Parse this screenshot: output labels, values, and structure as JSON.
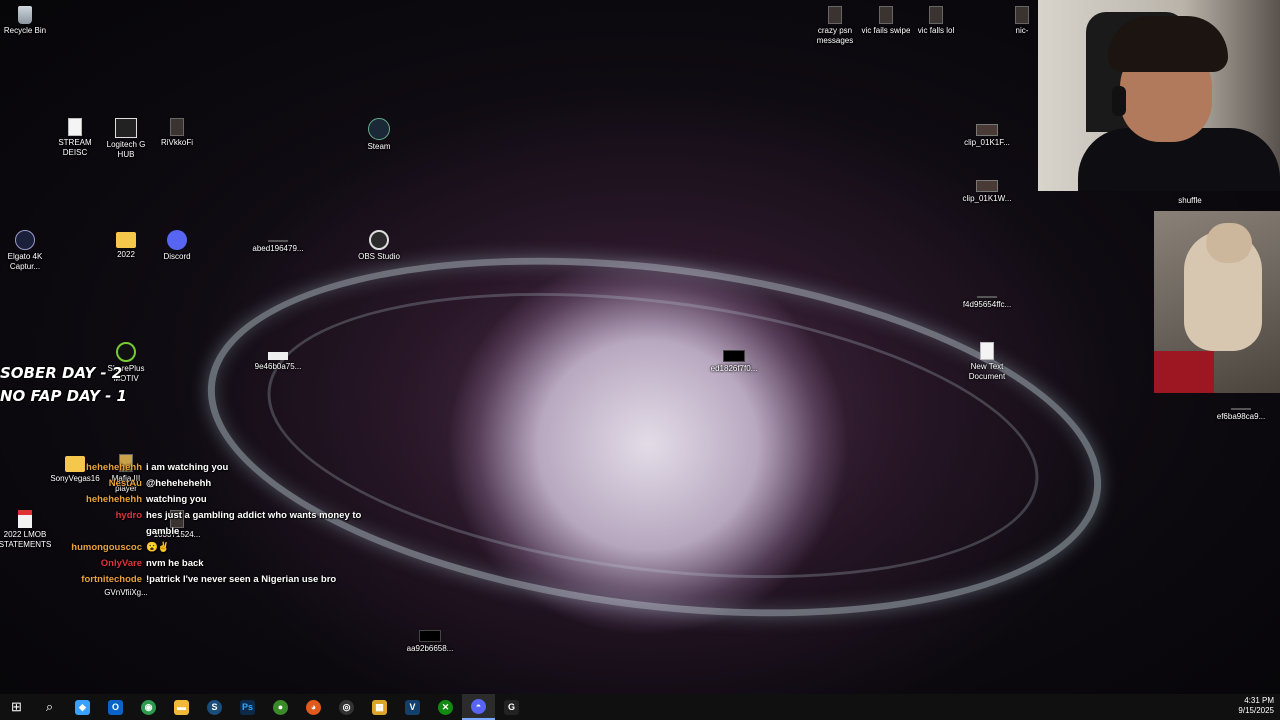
{
  "desktop": {
    "icons": [
      {
        "label": "Recycle Bin"
      },
      {
        "label": "crazy psn\nmessages"
      },
      {
        "label": "vic fails swipe"
      },
      {
        "label": "vic falls lol"
      },
      {
        "label": "nic-"
      },
      {
        "label": "STREAM\nDEISC"
      },
      {
        "label": "Logitech G\nHUB"
      },
      {
        "label": "RiVkkoFi"
      },
      {
        "label": "Steam"
      },
      {
        "label": "clip_01K1F..."
      },
      {
        "label": "clip_01K1W..."
      },
      {
        "label": "Elgato 4K\nCaptur..."
      },
      {
        "label": "2022"
      },
      {
        "label": "Discord"
      },
      {
        "label": "abed196479..."
      },
      {
        "label": "OBS Studio"
      },
      {
        "label": "f4d95654ffc..."
      },
      {
        "label": "ShurePlus\nMOTIV"
      },
      {
        "label": "9e46b0a75..."
      },
      {
        "label": "ed1826f7f0..."
      },
      {
        "label": "New Text\nDocument"
      },
      {
        "label": "ef6ba98ca9..."
      },
      {
        "label": "SonyVegas16"
      },
      {
        "label": "Mafia III\nplayer"
      },
      {
        "label": "2022 LMOB\nSTATEMENTS"
      },
      {
        "label": "103371524..."
      },
      {
        "label": "GVnVfiiXg..."
      },
      {
        "label": "aa92b6658..."
      }
    ]
  },
  "overlay": {
    "sober_line1": "SOBER DAY - 2",
    "sober_line2": "NO FAP DAY - 1",
    "shuffle_label": "shuffle"
  },
  "chat": {
    "messages": [
      {
        "user": "hehehehehh",
        "text": "i am watching you",
        "color": "#e8a33c"
      },
      {
        "user": "NestAu",
        "text": "@hehehehehh",
        "color": "#e8a33c"
      },
      {
        "user": "hehehehehh",
        "text": "watching you",
        "color": "#e8a33c"
      },
      {
        "user": "hydro",
        "text": "hes just a gambling addict who wants money to gamble",
        "color": "#e0343c"
      },
      {
        "user": "humongouscoc",
        "text": "😮✌",
        "color": "#e8a33c"
      },
      {
        "user": "OnlyVare",
        "text": "nvm he back",
        "color": "#e0343c"
      },
      {
        "user": "fortnitechode",
        "text": "!patrick I've never seen a Nigerian use bro",
        "color": "#e8a33c"
      }
    ]
  },
  "taskbar": {
    "items": [
      {
        "name": "windows-start",
        "glyph": "⊞"
      },
      {
        "name": "search",
        "glyph": "⌕"
      },
      {
        "name": "copilot",
        "glyph": "◆",
        "color": "#3aa0ff"
      },
      {
        "name": "outlook",
        "glyph": "O",
        "color": "#0a64c8"
      },
      {
        "name": "chrome",
        "glyph": "◉",
        "color": "#2e9a4e"
      },
      {
        "name": "file-explorer",
        "glyph": "▬",
        "color": "#f2b837"
      },
      {
        "name": "steam",
        "glyph": "S",
        "color": "#1b4d7a"
      },
      {
        "name": "photoshop",
        "glyph": "Ps",
        "color": "#0b2a4a"
      },
      {
        "name": "shure-motiv",
        "glyph": "●",
        "color": "#3a8a2a"
      },
      {
        "name": "firefox",
        "glyph": "◕",
        "color": "#e0591d"
      },
      {
        "name": "obs",
        "glyph": "◎",
        "color": "#333333"
      },
      {
        "name": "ms-store",
        "glyph": "▦",
        "color": "#d9a62a"
      },
      {
        "name": "vegas",
        "glyph": "V",
        "color": "#123f6b"
      },
      {
        "name": "xbox",
        "glyph": "✕",
        "color": "#128a12"
      },
      {
        "name": "discord",
        "glyph": "◓",
        "color": "#5865f2"
      },
      {
        "name": "g-hub",
        "glyph": "G",
        "color": "#222222"
      }
    ]
  },
  "clock": {
    "time": "4:31 PM",
    "date": "9/15/2025"
  }
}
